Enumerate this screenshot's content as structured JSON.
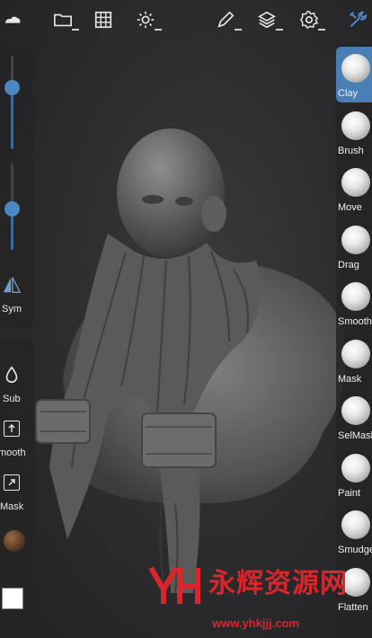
{
  "app": {
    "accent": "#4a7fb5",
    "watermark_color": "#d8262b"
  },
  "topbar": {
    "icons": [
      "cloud-icon",
      "folder-icon",
      "grid-icon",
      "sun-icon",
      "pen-icon",
      "layers-icon",
      "gear-icon",
      "tools-icon"
    ]
  },
  "left_top": {
    "radius_slider_value": 0.66,
    "intensity_slider_value": 0.48,
    "sym_label": "Sym"
  },
  "left_bottom": {
    "sub_label": "Sub",
    "smooth_label": "mooth",
    "mask_label": "Mask",
    "material_color": "#5a3a24",
    "color_swatch": "#ffffff"
  },
  "brushes": [
    {
      "label": "Clay",
      "active": true
    },
    {
      "label": "Brush",
      "active": false
    },
    {
      "label": "Move",
      "active": false
    },
    {
      "label": "Drag",
      "active": false
    },
    {
      "label": "Smooth",
      "active": false
    },
    {
      "label": "Mask",
      "active": false
    },
    {
      "label": "SelMask",
      "active": false
    },
    {
      "label": "Paint",
      "active": false
    },
    {
      "label": "Smudge",
      "active": false
    },
    {
      "label": "Flatten",
      "active": false
    }
  ],
  "watermark": {
    "text": "永辉资源网",
    "url": "www.yhkjjj.com"
  }
}
